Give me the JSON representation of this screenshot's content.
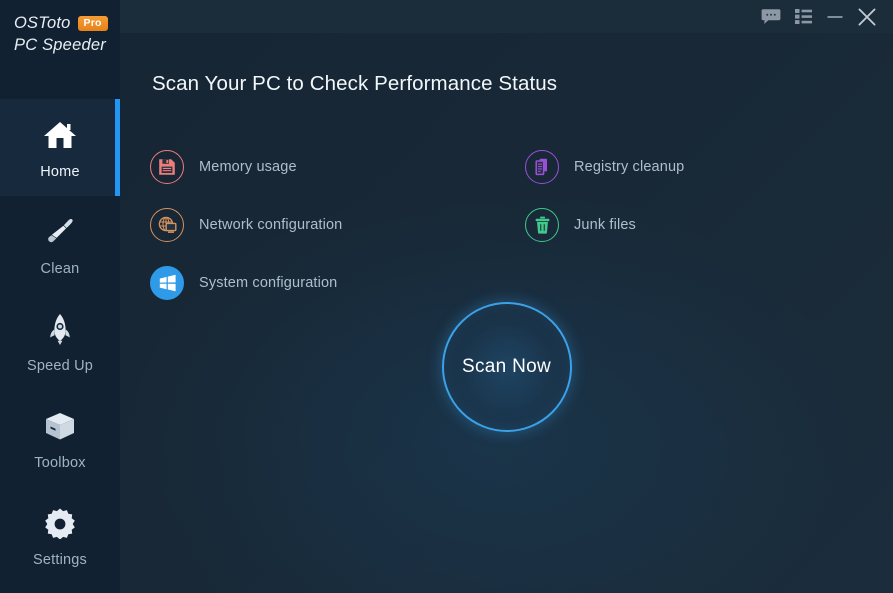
{
  "app": {
    "brand_name": "OSToto",
    "brand_badge": "Pro",
    "brand_sub": "PC Speeder",
    "accent_color": "#2196f3",
    "badge_color": "#ee8a1e"
  },
  "titlebar": {
    "buttons": [
      {
        "name": "feedback-icon",
        "label": "Feedback"
      },
      {
        "name": "menu-icon",
        "label": "Menu"
      },
      {
        "name": "minimize-icon",
        "label": "Minimize"
      },
      {
        "name": "close-icon",
        "label": "Close"
      }
    ]
  },
  "sidebar": {
    "items": [
      {
        "label": "Home",
        "icon": "home-icon",
        "active": true
      },
      {
        "label": "Clean",
        "icon": "brush-icon",
        "active": false
      },
      {
        "label": "Speed Up",
        "icon": "rocket-icon",
        "active": false
      },
      {
        "label": "Toolbox",
        "icon": "toolbox-icon",
        "active": false
      },
      {
        "label": "Settings",
        "icon": "gear-icon",
        "active": false
      }
    ]
  },
  "main": {
    "heading": "Scan Your PC to Check Performance Status",
    "features": [
      {
        "label": "Memory usage",
        "icon": "floppy-disk-icon",
        "color": "#ef7b7b"
      },
      {
        "label": "Registry cleanup",
        "icon": "documents-icon",
        "color": "#9a4fdb"
      },
      {
        "label": "Network configuration",
        "icon": "network-icon",
        "color": "#d4925e"
      },
      {
        "label": "Junk files",
        "icon": "trash-icon",
        "color": "#3fc98a"
      },
      {
        "label": "System configuration",
        "icon": "windows-icon",
        "color": "#2e9ae8"
      }
    ],
    "scan_button": "Scan Now"
  }
}
